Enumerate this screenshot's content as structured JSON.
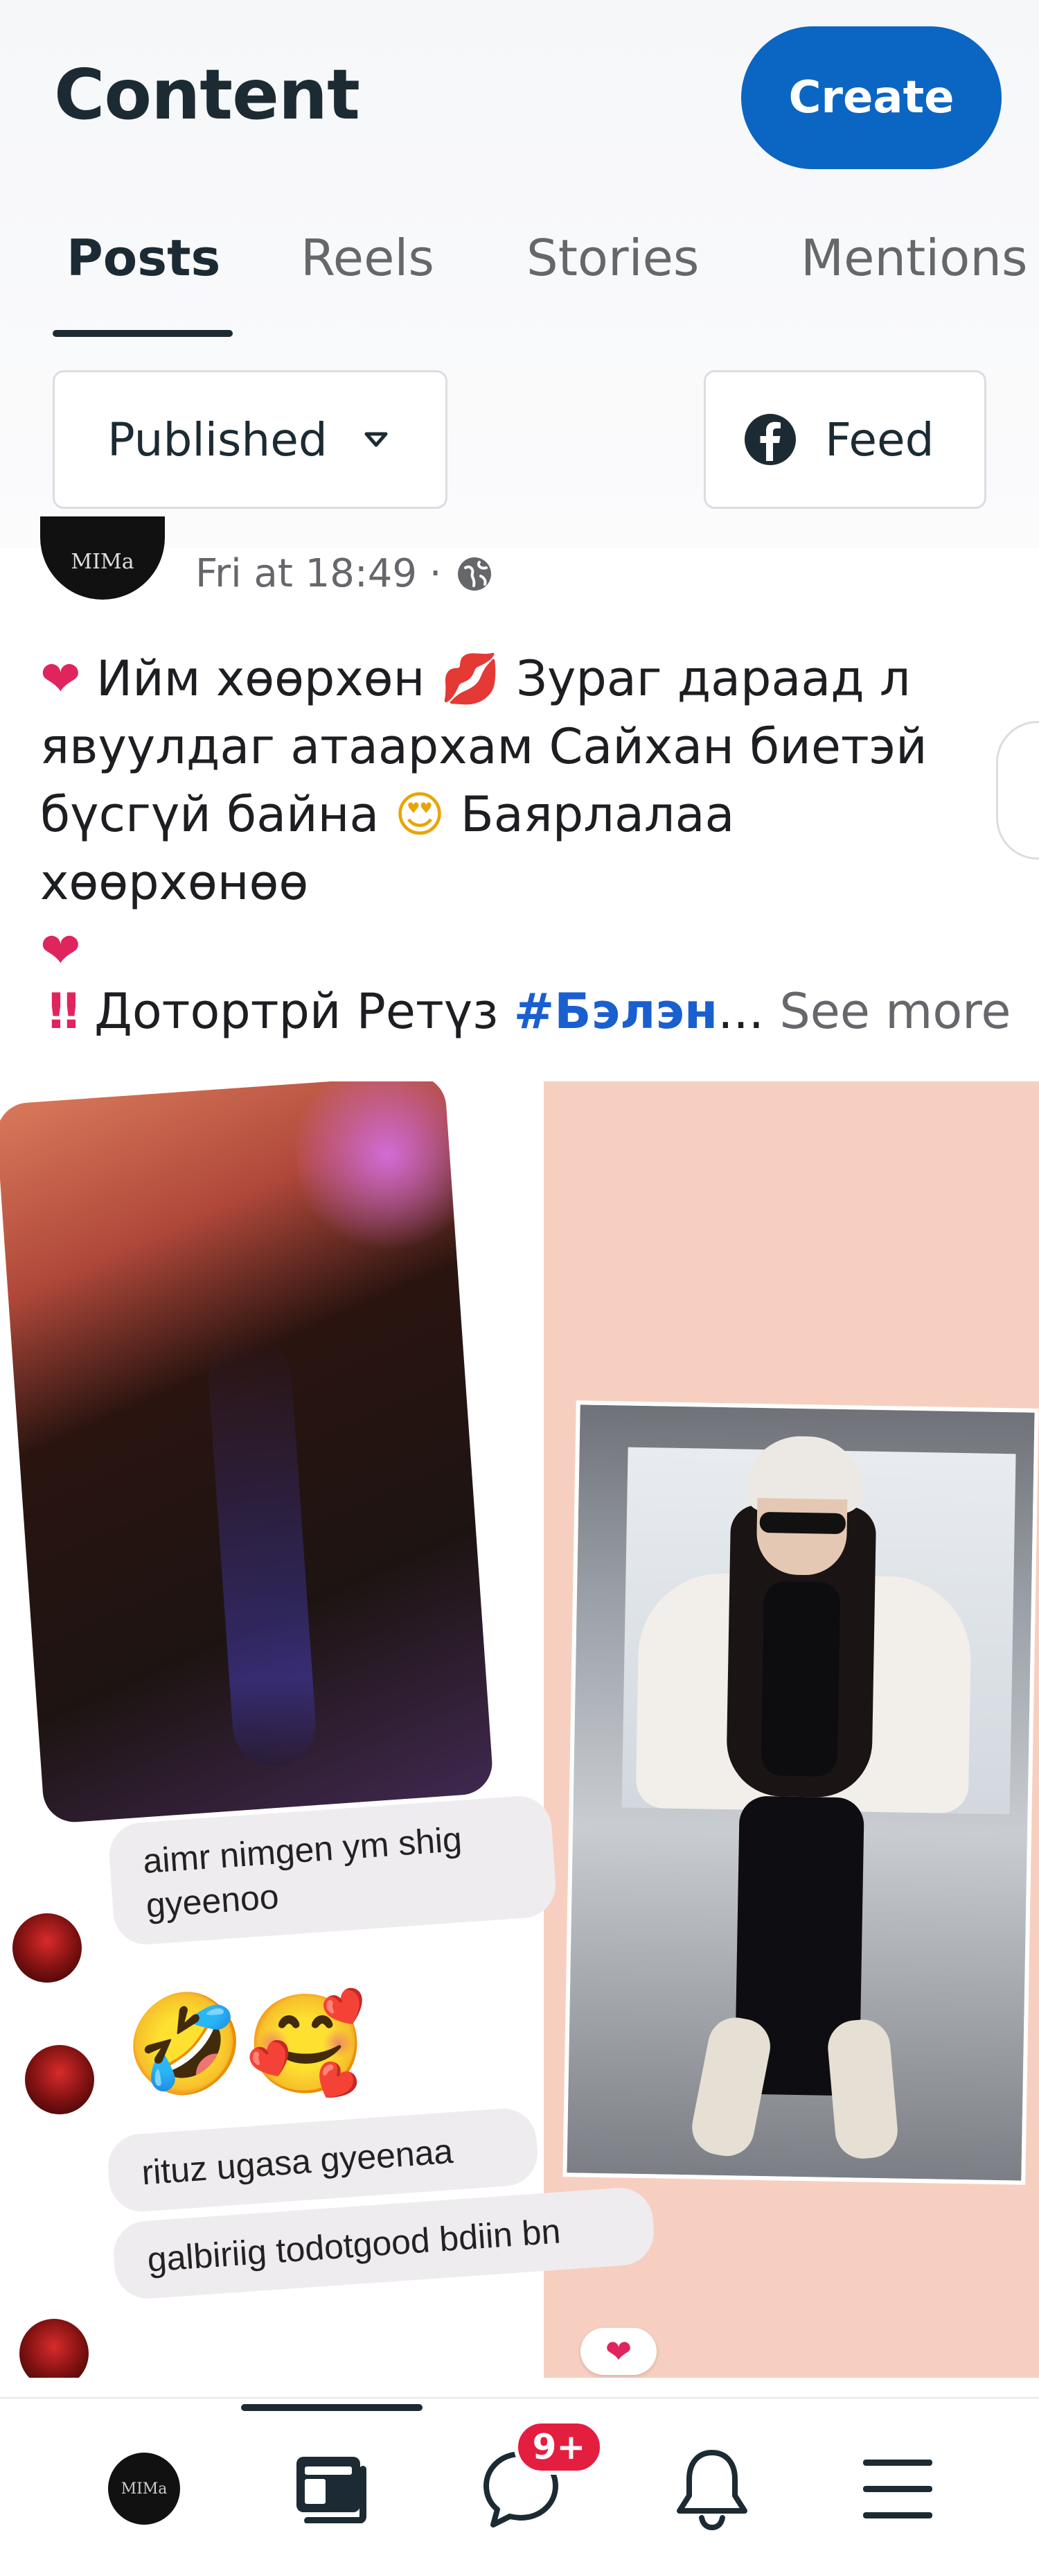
{
  "header": {
    "title": "Content",
    "create_label": "Create",
    "tabs": [
      {
        "label": "Posts",
        "active": true
      },
      {
        "label": "Reels",
        "active": false
      },
      {
        "label": "Stories",
        "active": false
      },
      {
        "label": "Mentions",
        "active": false
      }
    ],
    "filters": {
      "status_label": "Published",
      "feed_label": "Feed"
    }
  },
  "post": {
    "author_avatar_text": "MIMa",
    "timestamp": "Fri at 18:49 ·",
    "text": {
      "line1_a": "Ийм хөөрхөн",
      "line1_b": "Зураг дараад л",
      "line2": "явуулдаг атаархам Сайхан биетэй",
      "line3_a": "бүсгүй байна",
      "line3_b": "Баярлалаа хөөрхөнөө"
    },
    "second_line": {
      "prefix": "Дотортрй Ретүз",
      "hashtag": "#Бэлэн",
      "ellipsis": "...",
      "see_more": "See more"
    },
    "emojis": {
      "heart": "❤",
      "kiss": "💋",
      "star_eyes": "😍",
      "double_exclamation": "‼"
    }
  },
  "collage": {
    "comments": [
      {
        "text": "aimr nimgen ym shig gyeenoo"
      },
      {
        "text": "🤣🥰"
      },
      {
        "text": "rituz ugasa gyeenaa"
      },
      {
        "text": "galbiriig todotgood bdiin bn"
      }
    ],
    "reaction": "❤"
  },
  "bottom_nav": {
    "avatar_text": "MIMa",
    "notifications_badge": "9+",
    "icons": [
      "profile-avatar",
      "pages-icon",
      "messages-icon",
      "bell-icon",
      "menu-icon"
    ]
  },
  "colors": {
    "accent": "#0a66c2",
    "badge": "#e41e3f",
    "hashtag": "#1a5fd0",
    "collage_bg": "#f7cfc0"
  }
}
